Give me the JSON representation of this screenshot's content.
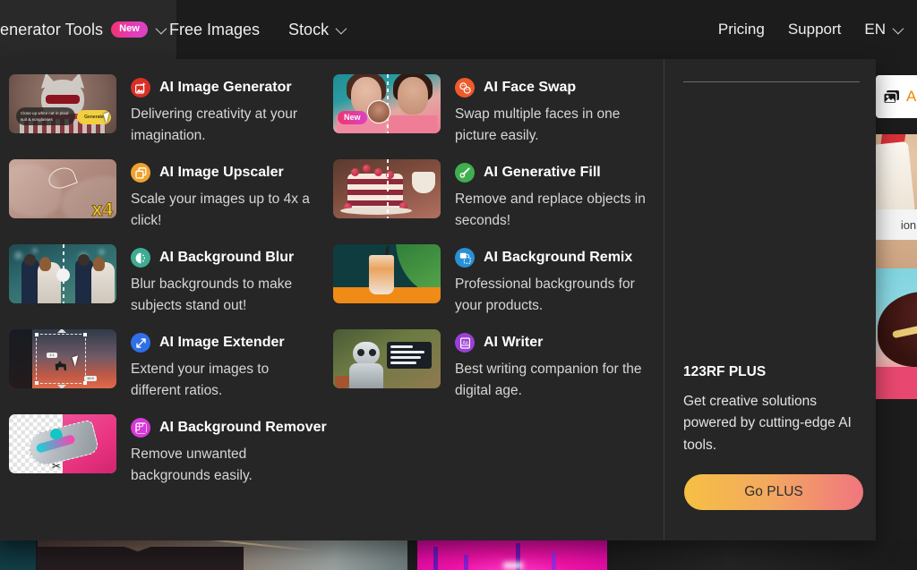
{
  "navbar": {
    "active_tab": {
      "label": "enerator Tools",
      "badge": "New",
      "icon": "chevron-down-icon"
    },
    "items": [
      {
        "label": "Free Images",
        "has_chevron": false
      },
      {
        "label": "Stock",
        "has_chevron": true
      }
    ],
    "right_items": [
      {
        "label": "Pricing",
        "has_chevron": false
      },
      {
        "label": "Support",
        "has_chevron": false
      },
      {
        "label": "EN",
        "has_chevron": true
      }
    ]
  },
  "background": {
    "filter_bar": {
      "label": "All",
      "icon": "image-stack-icon"
    },
    "thumb_caption": "ion..."
  },
  "dropdown": {
    "columns": [
      {
        "tools": [
          {
            "title": "AI Image Generator",
            "desc": "Delivering creativity at your imagination.",
            "icon": "image-sparkle-icon",
            "icon_color": "#d93025",
            "thumb": "cat-sunglasses",
            "thumb_prompt": "Close up white cat in plaid suit & sunglasses",
            "thumb_button": "Generate"
          },
          {
            "title": "AI Image Upscaler",
            "desc": "Scale your images up to 4x a click!",
            "icon": "upscale-squares-icon",
            "icon_color": "#f0a22e",
            "thumb": "fabric-x4",
            "thumb_label": "x4"
          },
          {
            "title": "AI Background Blur",
            "desc": "Blur backgrounds to make subjects stand out!",
            "icon": "blur-circle-icon",
            "icon_color": "#3fab93",
            "thumb": "wedding-couple"
          },
          {
            "title": "AI Image Extender",
            "desc": "Extend your images to different ratios.",
            "icon": "expand-arrows-icon",
            "icon_color": "#2f6fe8",
            "thumb": "deer-sunset"
          },
          {
            "title": "AI Background Remover",
            "desc": "Remove unwanted backgrounds easily.",
            "icon": "grid-cut-icon",
            "icon_color": "#d63ad6",
            "thumb": "sneaker-cutout"
          }
        ]
      },
      {
        "tools": [
          {
            "title": "AI Face Swap",
            "desc": "Swap multiple faces in one picture easily.",
            "icon": "faces-swap-icon",
            "icon_color": "#ef5a2a",
            "thumb": "two-women-faces",
            "thumb_badge": "New"
          },
          {
            "title": "AI Generative Fill",
            "desc": "Remove and replace objects in seconds!",
            "icon": "brush-icon",
            "icon_color": "#3fae4f",
            "thumb": "berry-cake"
          },
          {
            "title": "AI Background Remix",
            "desc": "Professional backgrounds for your products.",
            "icon": "remix-frame-icon",
            "icon_color": "#2a8fd6",
            "thumb": "iced-coffee"
          },
          {
            "title": "AI Writer",
            "desc": "Best writing companion for the digital age.",
            "icon": "writer-page-icon",
            "icon_color": "#9b3fd6",
            "thumb": "robot-writer"
          }
        ]
      }
    ],
    "promo": {
      "title": "123RF PLUS",
      "desc": "Get creative solutions powered by cutting-edge AI tools.",
      "button": "Go PLUS",
      "button_gradient": "#f5c043,#f0767e"
    }
  }
}
